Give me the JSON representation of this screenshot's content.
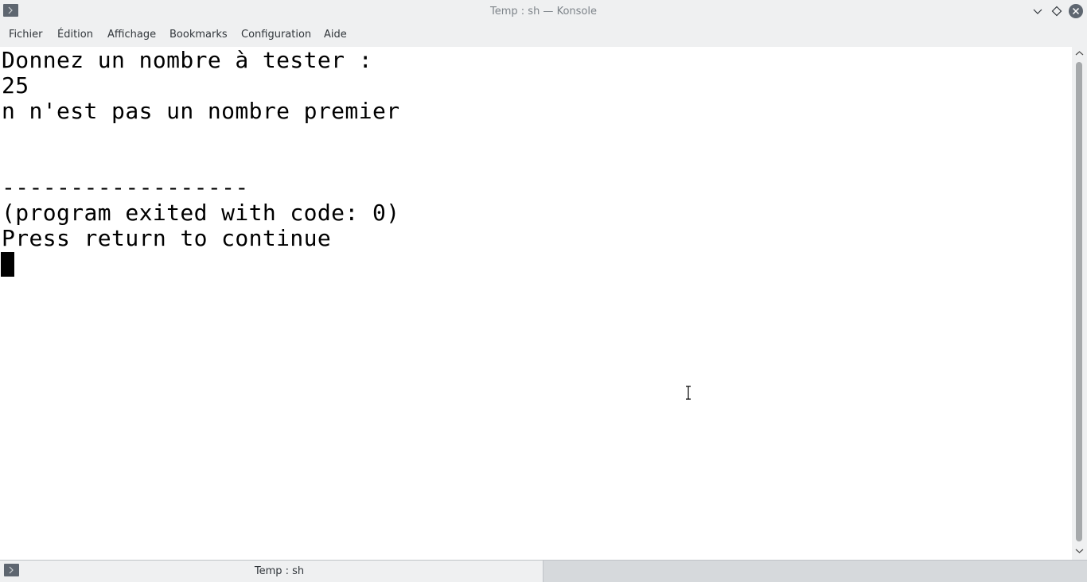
{
  "window": {
    "title": "Temp : sh — Konsole",
    "icon": "terminal-icon",
    "controls": [
      "minimize-icon",
      "maximize-icon",
      "close-icon"
    ]
  },
  "menubar": {
    "items": [
      {
        "label": "Fichier"
      },
      {
        "label": "Édition"
      },
      {
        "label": "Affichage"
      },
      {
        "label": "Bookmarks"
      },
      {
        "label": "Configuration"
      },
      {
        "label": "Aide"
      }
    ]
  },
  "terminal": {
    "lines": [
      "Donnez un nombre à tester :",
      "25",
      "n n'est pas un nombre premier",
      "",
      "",
      "------------------",
      "(program exited with code: 0)",
      "Press return to continue"
    ],
    "background": "#ffffff",
    "foreground": "#000000"
  },
  "tabs": [
    {
      "label": "Temp : sh",
      "active": true,
      "icon": "terminal-icon"
    }
  ],
  "colors": {
    "chrome": "#eff0f1",
    "title_text": "#7e848a",
    "menu_text": "#31363b",
    "close_button": "#5e6670"
  }
}
